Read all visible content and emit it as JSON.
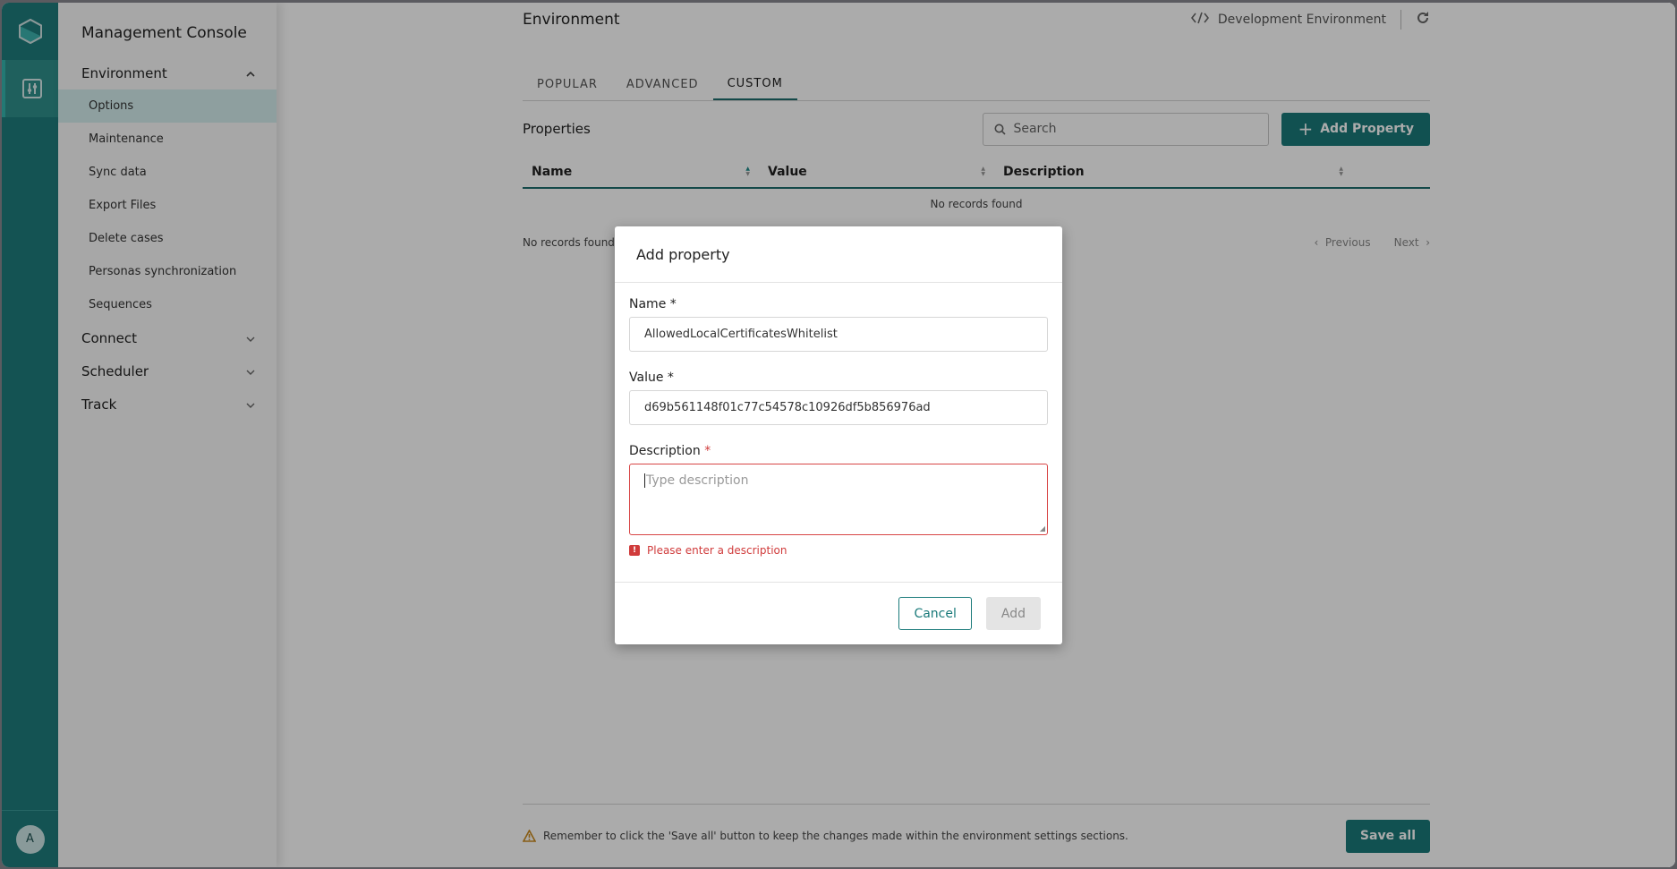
{
  "app": {
    "title": "Management Console",
    "avatar_initial": "A"
  },
  "nav": {
    "groups": [
      {
        "label": "Environment",
        "expanded": true,
        "items": [
          "Options",
          "Maintenance",
          "Sync data",
          "Export Files",
          "Delete cases",
          "Personas synchronization",
          "Sequences"
        ],
        "active_item": "Options"
      },
      {
        "label": "Connect",
        "expanded": false
      },
      {
        "label": "Scheduler",
        "expanded": false
      },
      {
        "label": "Track",
        "expanded": false
      }
    ]
  },
  "header": {
    "title": "Environment",
    "environment_label": "Development Environment"
  },
  "tabs": [
    {
      "label": "POPULAR",
      "active": false
    },
    {
      "label": "ADVANCED",
      "active": false
    },
    {
      "label": "CUSTOM",
      "active": true
    }
  ],
  "properties": {
    "heading": "Properties",
    "search_placeholder": "Search",
    "add_button": "Add Property",
    "columns": [
      "Name",
      "Value",
      "Description"
    ],
    "empty_table_text": "No records found",
    "footer_text": "No records found",
    "pager": {
      "previous": "Previous",
      "next": "Next"
    }
  },
  "bottom_bar": {
    "note": "Remember to click the 'Save all' button to keep the changes made within the environment settings sections.",
    "save_button": "Save all"
  },
  "dialog": {
    "title": "Add property",
    "name_label": "Name *",
    "name_value": "AllowedLocalCertificatesWhitelist",
    "value_label": "Value *",
    "value_value": "d69b561148f01c77c54578c10926df5b856976ad",
    "description_label": "Description",
    "description_required_mark": "*",
    "description_placeholder": "Type description",
    "error_text": "Please enter a description",
    "cancel_button": "Cancel",
    "add_button": "Add"
  },
  "colors": {
    "brand": "#1a7a7a",
    "error": "#d03b3b",
    "warning": "#c98a1e"
  }
}
